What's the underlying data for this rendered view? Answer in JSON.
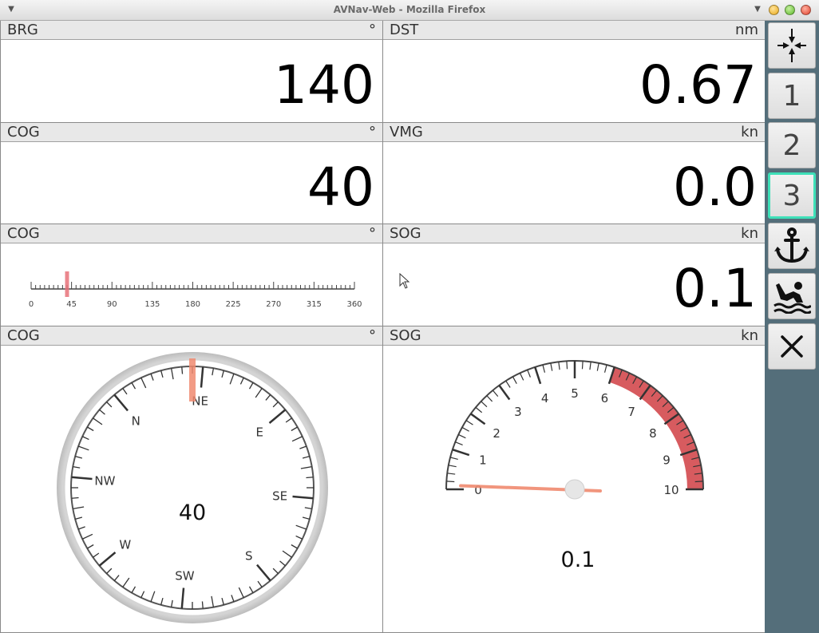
{
  "window": {
    "title": "AVNav-Web - Mozilla Firefox"
  },
  "widgets": {
    "brg": {
      "name": "BRG",
      "unit": "°",
      "value": "140"
    },
    "dst": {
      "name": "DST",
      "unit": "nm",
      "value": "0.67"
    },
    "cog1": {
      "name": "COG",
      "unit": "°",
      "value": "40"
    },
    "vmg": {
      "name": "VMG",
      "unit": "kn",
      "value": "0.0"
    },
    "cog_linear": {
      "name": "COG",
      "unit": "°",
      "value": 40,
      "min": 0,
      "max": 360,
      "tick_labels": [
        "0",
        "45",
        "90",
        "135",
        "180",
        "225",
        "270",
        "315",
        "360"
      ]
    },
    "sog1": {
      "name": "SOG",
      "unit": "kn",
      "value": "0.1"
    },
    "cog_compass": {
      "name": "COG",
      "unit": "°",
      "value": "40",
      "heading_deg": 40,
      "cardinal_labels": [
        "N",
        "NE",
        "E",
        "SE",
        "S",
        "SW",
        "W",
        "NW"
      ]
    },
    "sog_gauge": {
      "name": "SOG",
      "unit": "kn",
      "value": "0.1",
      "value_num": 0.1,
      "min": 0,
      "max": 10,
      "red_from": 6,
      "tick_labels": [
        "0",
        "1",
        "2",
        "3",
        "4",
        "5",
        "6",
        "7",
        "8",
        "9",
        "10"
      ]
    }
  },
  "sidebar": {
    "buttons": [
      {
        "icon": "collapse-arrows-icon",
        "label": ""
      },
      {
        "icon": "",
        "label": "1"
      },
      {
        "icon": "",
        "label": "2"
      },
      {
        "icon": "",
        "label": "3",
        "active": true
      },
      {
        "icon": "anchor-icon",
        "label": ""
      },
      {
        "icon": "man-overboard-icon",
        "label": ""
      },
      {
        "icon": "close-icon",
        "label": ""
      }
    ]
  },
  "colors": {
    "sidebar_bg": "#546e7a",
    "active_border": "#3ee0b8",
    "marker": "#e8727a",
    "needle": "#f08a70",
    "red_zone": "#d75b5f"
  }
}
